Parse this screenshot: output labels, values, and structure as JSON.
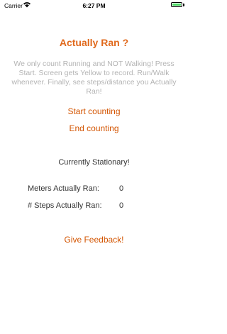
{
  "status_bar": {
    "carrier": "Carrier",
    "time": "6:27 PM"
  },
  "title": "Actually Ran ?",
  "description": "We only count Running and NOT Walking! Press Start. Screen gets Yellow to record. Run/Walk whenever. Finally, see steps/distance you Actually Ran!",
  "buttons": {
    "start": "Start counting",
    "end": "End counting",
    "feedback": "Give Feedback!"
  },
  "status": "Currently Stationary!",
  "metrics": [
    {
      "label": "Meters Actually Ran:",
      "value": "0"
    },
    {
      "label": "# Steps Actually Ran:",
      "value": "0"
    }
  ],
  "colors": {
    "accent": "#e0681b",
    "description": "#b4b4b4",
    "battery": "#4cd964"
  }
}
